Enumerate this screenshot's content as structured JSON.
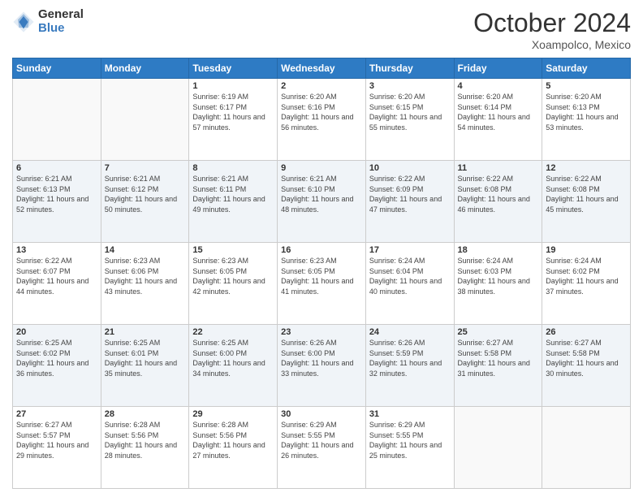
{
  "logo": {
    "general": "General",
    "blue": "Blue"
  },
  "header": {
    "month": "October 2024",
    "location": "Xoampolco, Mexico"
  },
  "weekdays": [
    "Sunday",
    "Monday",
    "Tuesday",
    "Wednesday",
    "Thursday",
    "Friday",
    "Saturday"
  ],
  "weeks": [
    [
      {
        "day": "",
        "sunrise": "",
        "sunset": "",
        "daylight": ""
      },
      {
        "day": "",
        "sunrise": "",
        "sunset": "",
        "daylight": ""
      },
      {
        "day": "1",
        "sunrise": "Sunrise: 6:19 AM",
        "sunset": "Sunset: 6:17 PM",
        "daylight": "Daylight: 11 hours and 57 minutes."
      },
      {
        "day": "2",
        "sunrise": "Sunrise: 6:20 AM",
        "sunset": "Sunset: 6:16 PM",
        "daylight": "Daylight: 11 hours and 56 minutes."
      },
      {
        "day": "3",
        "sunrise": "Sunrise: 6:20 AM",
        "sunset": "Sunset: 6:15 PM",
        "daylight": "Daylight: 11 hours and 55 minutes."
      },
      {
        "day": "4",
        "sunrise": "Sunrise: 6:20 AM",
        "sunset": "Sunset: 6:14 PM",
        "daylight": "Daylight: 11 hours and 54 minutes."
      },
      {
        "day": "5",
        "sunrise": "Sunrise: 6:20 AM",
        "sunset": "Sunset: 6:13 PM",
        "daylight": "Daylight: 11 hours and 53 minutes."
      }
    ],
    [
      {
        "day": "6",
        "sunrise": "Sunrise: 6:21 AM",
        "sunset": "Sunset: 6:13 PM",
        "daylight": "Daylight: 11 hours and 52 minutes."
      },
      {
        "day": "7",
        "sunrise": "Sunrise: 6:21 AM",
        "sunset": "Sunset: 6:12 PM",
        "daylight": "Daylight: 11 hours and 50 minutes."
      },
      {
        "day": "8",
        "sunrise": "Sunrise: 6:21 AM",
        "sunset": "Sunset: 6:11 PM",
        "daylight": "Daylight: 11 hours and 49 minutes."
      },
      {
        "day": "9",
        "sunrise": "Sunrise: 6:21 AM",
        "sunset": "Sunset: 6:10 PM",
        "daylight": "Daylight: 11 hours and 48 minutes."
      },
      {
        "day": "10",
        "sunrise": "Sunrise: 6:22 AM",
        "sunset": "Sunset: 6:09 PM",
        "daylight": "Daylight: 11 hours and 47 minutes."
      },
      {
        "day": "11",
        "sunrise": "Sunrise: 6:22 AM",
        "sunset": "Sunset: 6:08 PM",
        "daylight": "Daylight: 11 hours and 46 minutes."
      },
      {
        "day": "12",
        "sunrise": "Sunrise: 6:22 AM",
        "sunset": "Sunset: 6:08 PM",
        "daylight": "Daylight: 11 hours and 45 minutes."
      }
    ],
    [
      {
        "day": "13",
        "sunrise": "Sunrise: 6:22 AM",
        "sunset": "Sunset: 6:07 PM",
        "daylight": "Daylight: 11 hours and 44 minutes."
      },
      {
        "day": "14",
        "sunrise": "Sunrise: 6:23 AM",
        "sunset": "Sunset: 6:06 PM",
        "daylight": "Daylight: 11 hours and 43 minutes."
      },
      {
        "day": "15",
        "sunrise": "Sunrise: 6:23 AM",
        "sunset": "Sunset: 6:05 PM",
        "daylight": "Daylight: 11 hours and 42 minutes."
      },
      {
        "day": "16",
        "sunrise": "Sunrise: 6:23 AM",
        "sunset": "Sunset: 6:05 PM",
        "daylight": "Daylight: 11 hours and 41 minutes."
      },
      {
        "day": "17",
        "sunrise": "Sunrise: 6:24 AM",
        "sunset": "Sunset: 6:04 PM",
        "daylight": "Daylight: 11 hours and 40 minutes."
      },
      {
        "day": "18",
        "sunrise": "Sunrise: 6:24 AM",
        "sunset": "Sunset: 6:03 PM",
        "daylight": "Daylight: 11 hours and 38 minutes."
      },
      {
        "day": "19",
        "sunrise": "Sunrise: 6:24 AM",
        "sunset": "Sunset: 6:02 PM",
        "daylight": "Daylight: 11 hours and 37 minutes."
      }
    ],
    [
      {
        "day": "20",
        "sunrise": "Sunrise: 6:25 AM",
        "sunset": "Sunset: 6:02 PM",
        "daylight": "Daylight: 11 hours and 36 minutes."
      },
      {
        "day": "21",
        "sunrise": "Sunrise: 6:25 AM",
        "sunset": "Sunset: 6:01 PM",
        "daylight": "Daylight: 11 hours and 35 minutes."
      },
      {
        "day": "22",
        "sunrise": "Sunrise: 6:25 AM",
        "sunset": "Sunset: 6:00 PM",
        "daylight": "Daylight: 11 hours and 34 minutes."
      },
      {
        "day": "23",
        "sunrise": "Sunrise: 6:26 AM",
        "sunset": "Sunset: 6:00 PM",
        "daylight": "Daylight: 11 hours and 33 minutes."
      },
      {
        "day": "24",
        "sunrise": "Sunrise: 6:26 AM",
        "sunset": "Sunset: 5:59 PM",
        "daylight": "Daylight: 11 hours and 32 minutes."
      },
      {
        "day": "25",
        "sunrise": "Sunrise: 6:27 AM",
        "sunset": "Sunset: 5:58 PM",
        "daylight": "Daylight: 11 hours and 31 minutes."
      },
      {
        "day": "26",
        "sunrise": "Sunrise: 6:27 AM",
        "sunset": "Sunset: 5:58 PM",
        "daylight": "Daylight: 11 hours and 30 minutes."
      }
    ],
    [
      {
        "day": "27",
        "sunrise": "Sunrise: 6:27 AM",
        "sunset": "Sunset: 5:57 PM",
        "daylight": "Daylight: 11 hours and 29 minutes."
      },
      {
        "day": "28",
        "sunrise": "Sunrise: 6:28 AM",
        "sunset": "Sunset: 5:56 PM",
        "daylight": "Daylight: 11 hours and 28 minutes."
      },
      {
        "day": "29",
        "sunrise": "Sunrise: 6:28 AM",
        "sunset": "Sunset: 5:56 PM",
        "daylight": "Daylight: 11 hours and 27 minutes."
      },
      {
        "day": "30",
        "sunrise": "Sunrise: 6:29 AM",
        "sunset": "Sunset: 5:55 PM",
        "daylight": "Daylight: 11 hours and 26 minutes."
      },
      {
        "day": "31",
        "sunrise": "Sunrise: 6:29 AM",
        "sunset": "Sunset: 5:55 PM",
        "daylight": "Daylight: 11 hours and 25 minutes."
      },
      {
        "day": "",
        "sunrise": "",
        "sunset": "",
        "daylight": ""
      },
      {
        "day": "",
        "sunrise": "",
        "sunset": "",
        "daylight": ""
      }
    ]
  ]
}
